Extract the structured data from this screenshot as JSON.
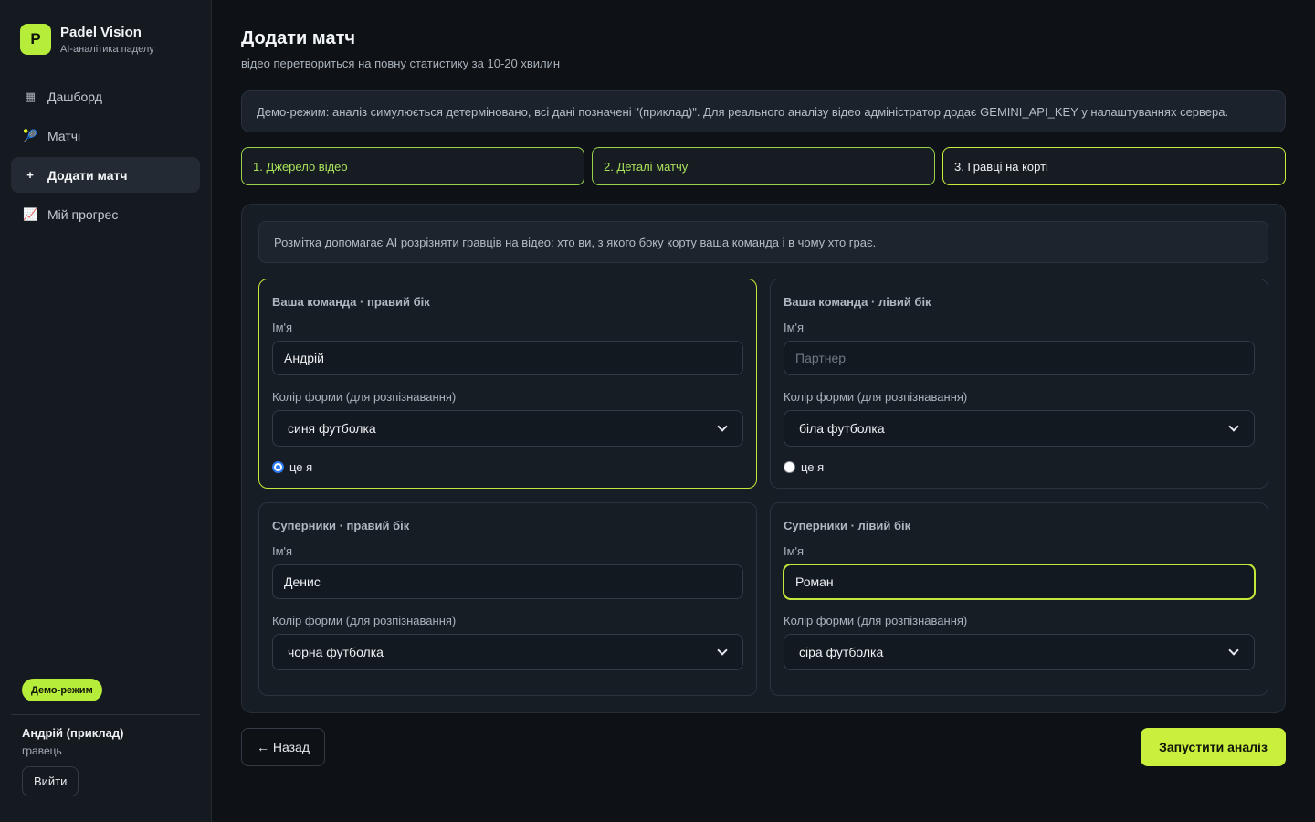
{
  "brand": {
    "logo_letter": "P",
    "name": "Padel Vision",
    "subtitle": "AI-аналітика паделу"
  },
  "nav": [
    {
      "icon": "dashboard-icon",
      "glyph": "▦",
      "label": "Дашборд",
      "active": false
    },
    {
      "icon": "racket-icon",
      "glyph": "🎾",
      "label": "Матчі",
      "active": false
    },
    {
      "icon": "plus-icon",
      "glyph": "+",
      "label": "Додати матч",
      "active": true
    },
    {
      "icon": "chart-icon",
      "glyph": "📈",
      "label": "Мій прогрес",
      "active": false
    }
  ],
  "sidebar_footer": {
    "demo_badge": "Демо-режим",
    "user_name": "Андрій (приклад)",
    "user_role": "гравець",
    "logout_label": "Вийти"
  },
  "page": {
    "title": "Додати матч",
    "subtitle": "відео перетвориться на повну статистику за 10-20 хвилин",
    "notice": "Демо-режим: аналіз симулюється детерміновано, всі дані позначені \"(приклад)\". Для реального аналізу відео адміністратор додає GEMINI_API_KEY у налаштуваннях сервера."
  },
  "steps": [
    {
      "label": "1. Джерело відео",
      "state": "done"
    },
    {
      "label": "2. Деталі матчу",
      "state": "done"
    },
    {
      "label": "3. Гравці на корті",
      "state": "current"
    }
  ],
  "players_form": {
    "hint": "Розмітка допомагає AI розрізняти гравців на відео: хто ви, з якого боку корту ваша команда і в чому хто грає.",
    "name_label": "Ім'я",
    "color_label": "Колір форми (для розпізнавання)",
    "me_label": "це я",
    "players": [
      {
        "title": "Ваша команда · правий бік",
        "name_value": "Андрій",
        "name_placeholder": "",
        "color": "синя футболка",
        "is_me": true
      },
      {
        "title": "Ваша команда · лівий бік",
        "name_value": "",
        "name_placeholder": "Партнер",
        "color": "біла футболка",
        "is_me": false
      },
      {
        "title": "Суперники · правий бік",
        "name_value": "Денис",
        "name_placeholder": "",
        "color": "чорна футболка"
      },
      {
        "title": "Суперники · лівий бік",
        "name_value": "Роман",
        "name_placeholder": "",
        "color": "сіра футболка"
      }
    ]
  },
  "actions": {
    "back_label": "← Назад",
    "run_label": "Запустити аналіз"
  },
  "colors": {
    "accent": "#c8f03c",
    "step_done": "#9ad14a",
    "radio_checked": "#2f7cf6",
    "background": "#0e1217"
  }
}
